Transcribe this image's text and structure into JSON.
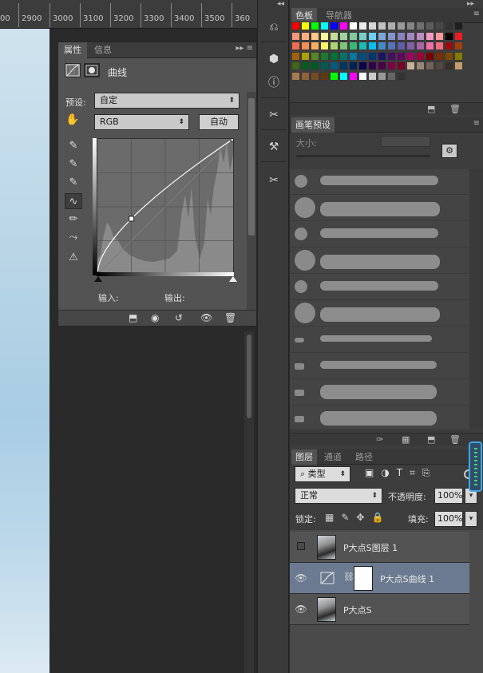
{
  "ruler": {
    "ticks": [
      "2900",
      "3000",
      "3100",
      "3200",
      "3300",
      "3400",
      "3500",
      "360"
    ],
    "left_clip": "00"
  },
  "properties": {
    "tab_active": "属性",
    "tab_inactive": "信息",
    "adjustment_title": "曲线",
    "preset_label": "预设:",
    "preset_value": "自定",
    "channel_value": "RGB",
    "auto_button": "自动",
    "input_label": "输入:",
    "output_label": "输出:",
    "curve_points": [
      [
        0,
        0
      ],
      [
        64,
        105
      ],
      [
        255,
        255
      ]
    ]
  },
  "swatches": {
    "tab_active": "色板",
    "tab_inactive": "导航器",
    "colors": [
      "#ff0000",
      "#ffff00",
      "#00ff00",
      "#00ffff",
      "#0000ff",
      "#ff00ff",
      "#ffffff",
      "#ebebeb",
      "#d6d6d6",
      "#c2c2c2",
      "#adadad",
      "#999999",
      "#858585",
      "#707070",
      "#5c5c5c",
      "#474747",
      "#333333",
      "#1f1f1f",
      "#f7977a",
      "#f9ad81",
      "#fdc68a",
      "#fff79a",
      "#c4df9b",
      "#a2d39c",
      "#82ca9d",
      "#7bcdc8",
      "#6ecff6",
      "#7ea7d8",
      "#8493ca",
      "#8882be",
      "#a187be",
      "#bc8dbf",
      "#f49ac2",
      "#f6989d",
      "#000000",
      "#ed1c24",
      "#f26c4f",
      "#f68e55",
      "#fbaf5c",
      "#fff467",
      "#acd372",
      "#7cc576",
      "#3bb878",
      "#1abbb4",
      "#00bff3",
      "#438cca",
      "#5574b9",
      "#605ca8",
      "#855fa8",
      "#a763a8",
      "#f06ea9",
      "#f26d7d",
      "#9e0b0f",
      "#a0410d",
      "#a36209",
      "#aba000",
      "#598527",
      "#1a7b30",
      "#007236",
      "#00746b",
      "#0076a3",
      "#004b80",
      "#003471",
      "#1b1464",
      "#440e62",
      "#630460",
      "#9e005d",
      "#9e0039",
      "#790000",
      "#7b2e00",
      "#7d4900",
      "#827b00",
      "#406618",
      "#005e20",
      "#005826",
      "#005952",
      "#005b7f",
      "#003663",
      "#002157",
      "#0d004c",
      "#32004b",
      "#4b0049",
      "#7b0046",
      "#7a0026",
      "#c7b299",
      "#998675",
      "#736357",
      "#534741",
      "#37302a",
      "#c69c6d",
      "#a67c52",
      "#8c6239",
      "#754c24",
      "#603913",
      "#00ff00",
      "#00ffff",
      "#ff00ff",
      "#ffffff",
      "#cccccc",
      "#999999",
      "#666666",
      "#333333"
    ]
  },
  "brush_presets": {
    "tab_label": "画笔预设",
    "size_label": "大小:"
  },
  "layers": {
    "tab_layers": "图层",
    "tab_channels": "通道",
    "tab_paths": "路径",
    "filter_label": "类型",
    "blend_mode": "正常",
    "opacity_label": "不透明度:",
    "opacity_value": "100%",
    "lock_label": "锁定:",
    "fill_label": "填充:",
    "fill_value": "100%",
    "items": [
      {
        "name": "P大点S图层 1",
        "visible": false,
        "selected": false,
        "type": "pixel"
      },
      {
        "name": "P大点S曲线 1",
        "visible": true,
        "selected": true,
        "type": "adjustment"
      },
      {
        "name": "P大点S",
        "visible": true,
        "selected": false,
        "type": "pixel"
      }
    ]
  }
}
